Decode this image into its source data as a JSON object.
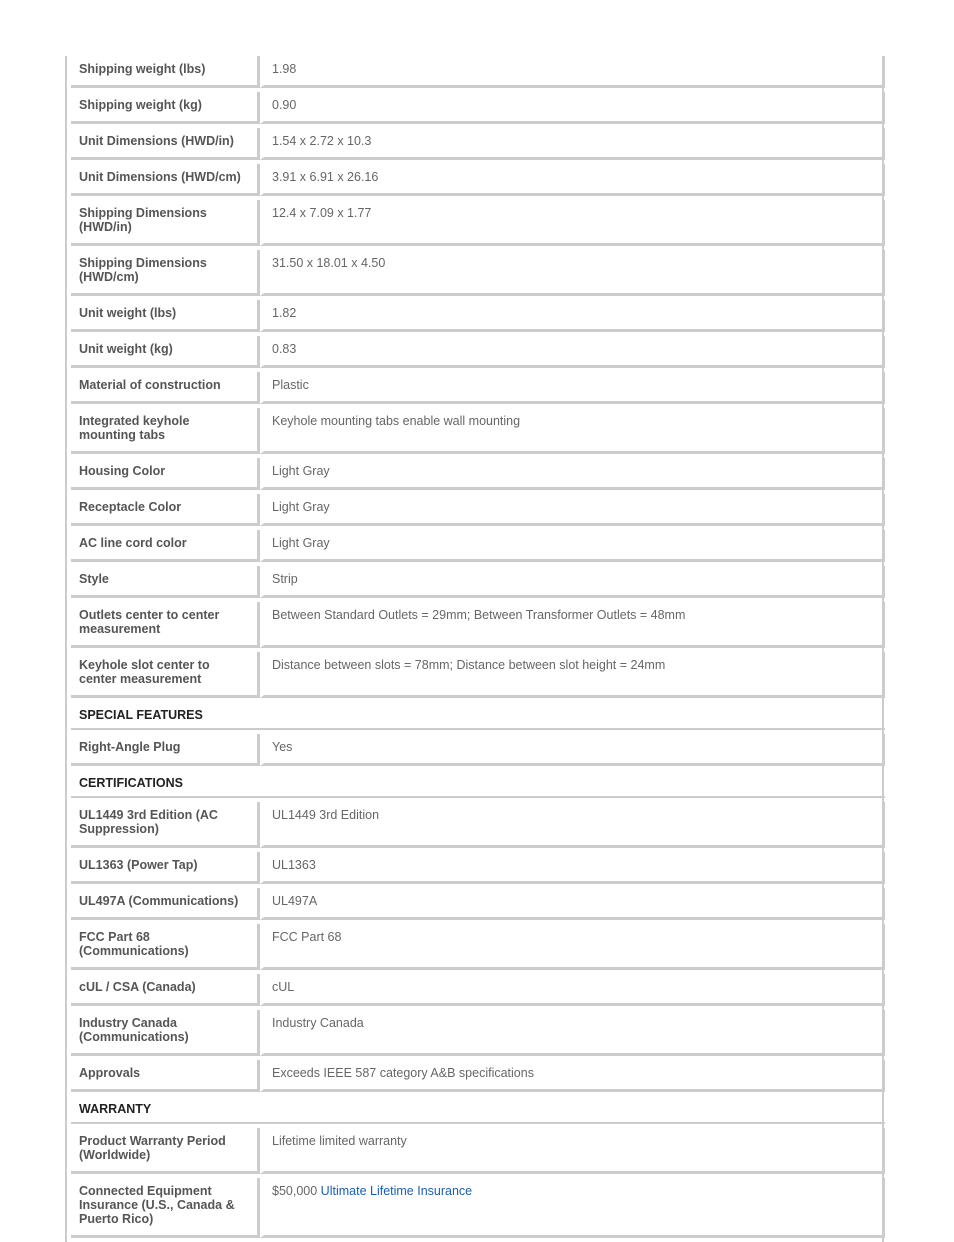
{
  "rows": [
    {
      "type": "row",
      "label": "Shipping weight (lbs)",
      "value": "1.98"
    },
    {
      "type": "row",
      "label": "Shipping weight (kg)",
      "value": "0.90"
    },
    {
      "type": "row",
      "label": "Unit Dimensions (HWD/in)",
      "value": "1.54 x 2.72 x 10.3"
    },
    {
      "type": "row",
      "label": "Unit Dimensions (HWD/cm)",
      "value": "3.91 x 6.91 x 26.16"
    },
    {
      "type": "row",
      "label": "Shipping Dimensions (HWD/in)",
      "value": "12.4 x 7.09 x 1.77",
      "lines": 2
    },
    {
      "type": "row",
      "label": "Shipping Dimensions (HWD/cm)",
      "value": "31.50 x 18.01 x 4.50",
      "lines": 2
    },
    {
      "type": "row",
      "label": "Unit weight (lbs)",
      "value": "1.82"
    },
    {
      "type": "row",
      "label": "Unit weight (kg)",
      "value": "0.83"
    },
    {
      "type": "row",
      "label": "Material of construction",
      "value": "Plastic"
    },
    {
      "type": "row",
      "label": "Integrated keyhole mounting tabs",
      "value": "Keyhole mounting tabs enable wall mounting",
      "lines": 2
    },
    {
      "type": "row",
      "label": "Housing Color",
      "value": "Light Gray"
    },
    {
      "type": "row",
      "label": "Receptacle Color",
      "value": "Light Gray"
    },
    {
      "type": "row",
      "label": "AC line cord color",
      "value": "Light Gray"
    },
    {
      "type": "row",
      "label": "Style",
      "value": "Strip"
    },
    {
      "type": "row",
      "label": "Outlets center to center measurement",
      "value": "Between Standard Outlets = 29mm; Between Transformer Outlets = 48mm",
      "lines": 2
    },
    {
      "type": "row",
      "label": "Keyhole slot center to center measurement",
      "value": "Distance between slots = 78mm; Distance between slot height = 24mm",
      "lines": 2
    },
    {
      "type": "section",
      "label": "SPECIAL FEATURES"
    },
    {
      "type": "row",
      "label": "Right-Angle Plug",
      "value": "Yes"
    },
    {
      "type": "section",
      "label": "CERTIFICATIONS"
    },
    {
      "type": "row",
      "label": "UL1449 3rd Edition (AC Suppression)",
      "value": "UL1449 3rd Edition",
      "lines": 2
    },
    {
      "type": "row",
      "label": "UL1363 (Power Tap)",
      "value": "UL1363"
    },
    {
      "type": "row",
      "label": "UL497A (Communications)",
      "value": "UL497A"
    },
    {
      "type": "row",
      "label": "FCC Part 68 (Communications)",
      "value": "FCC Part 68",
      "lines": 2
    },
    {
      "type": "row",
      "label": "cUL / CSA (Canada)",
      "value": "cUL"
    },
    {
      "type": "row",
      "label": "Industry Canada (Communications)",
      "value": "Industry Canada",
      "lines": 2
    },
    {
      "type": "row",
      "label": "Approvals",
      "value": "Exceeds IEEE 587 category A&B specifications"
    },
    {
      "type": "section",
      "label": "WARRANTY"
    },
    {
      "type": "row",
      "label": "Product Warranty Period (Worldwide)",
      "value": "Lifetime limited warranty",
      "lines": 2
    },
    {
      "type": "row",
      "label": "Connected Equipment Insurance (U.S., Canada & Puerto Rico)",
      "value": "$50,000 ",
      "link": "Ultimate Lifetime Insurance",
      "lines": 3
    }
  ],
  "colors": {
    "border": "#cccccc",
    "label_text": "#555555",
    "value_text": "#666666",
    "section_text": "#222222",
    "link": "#1a5fb4"
  }
}
